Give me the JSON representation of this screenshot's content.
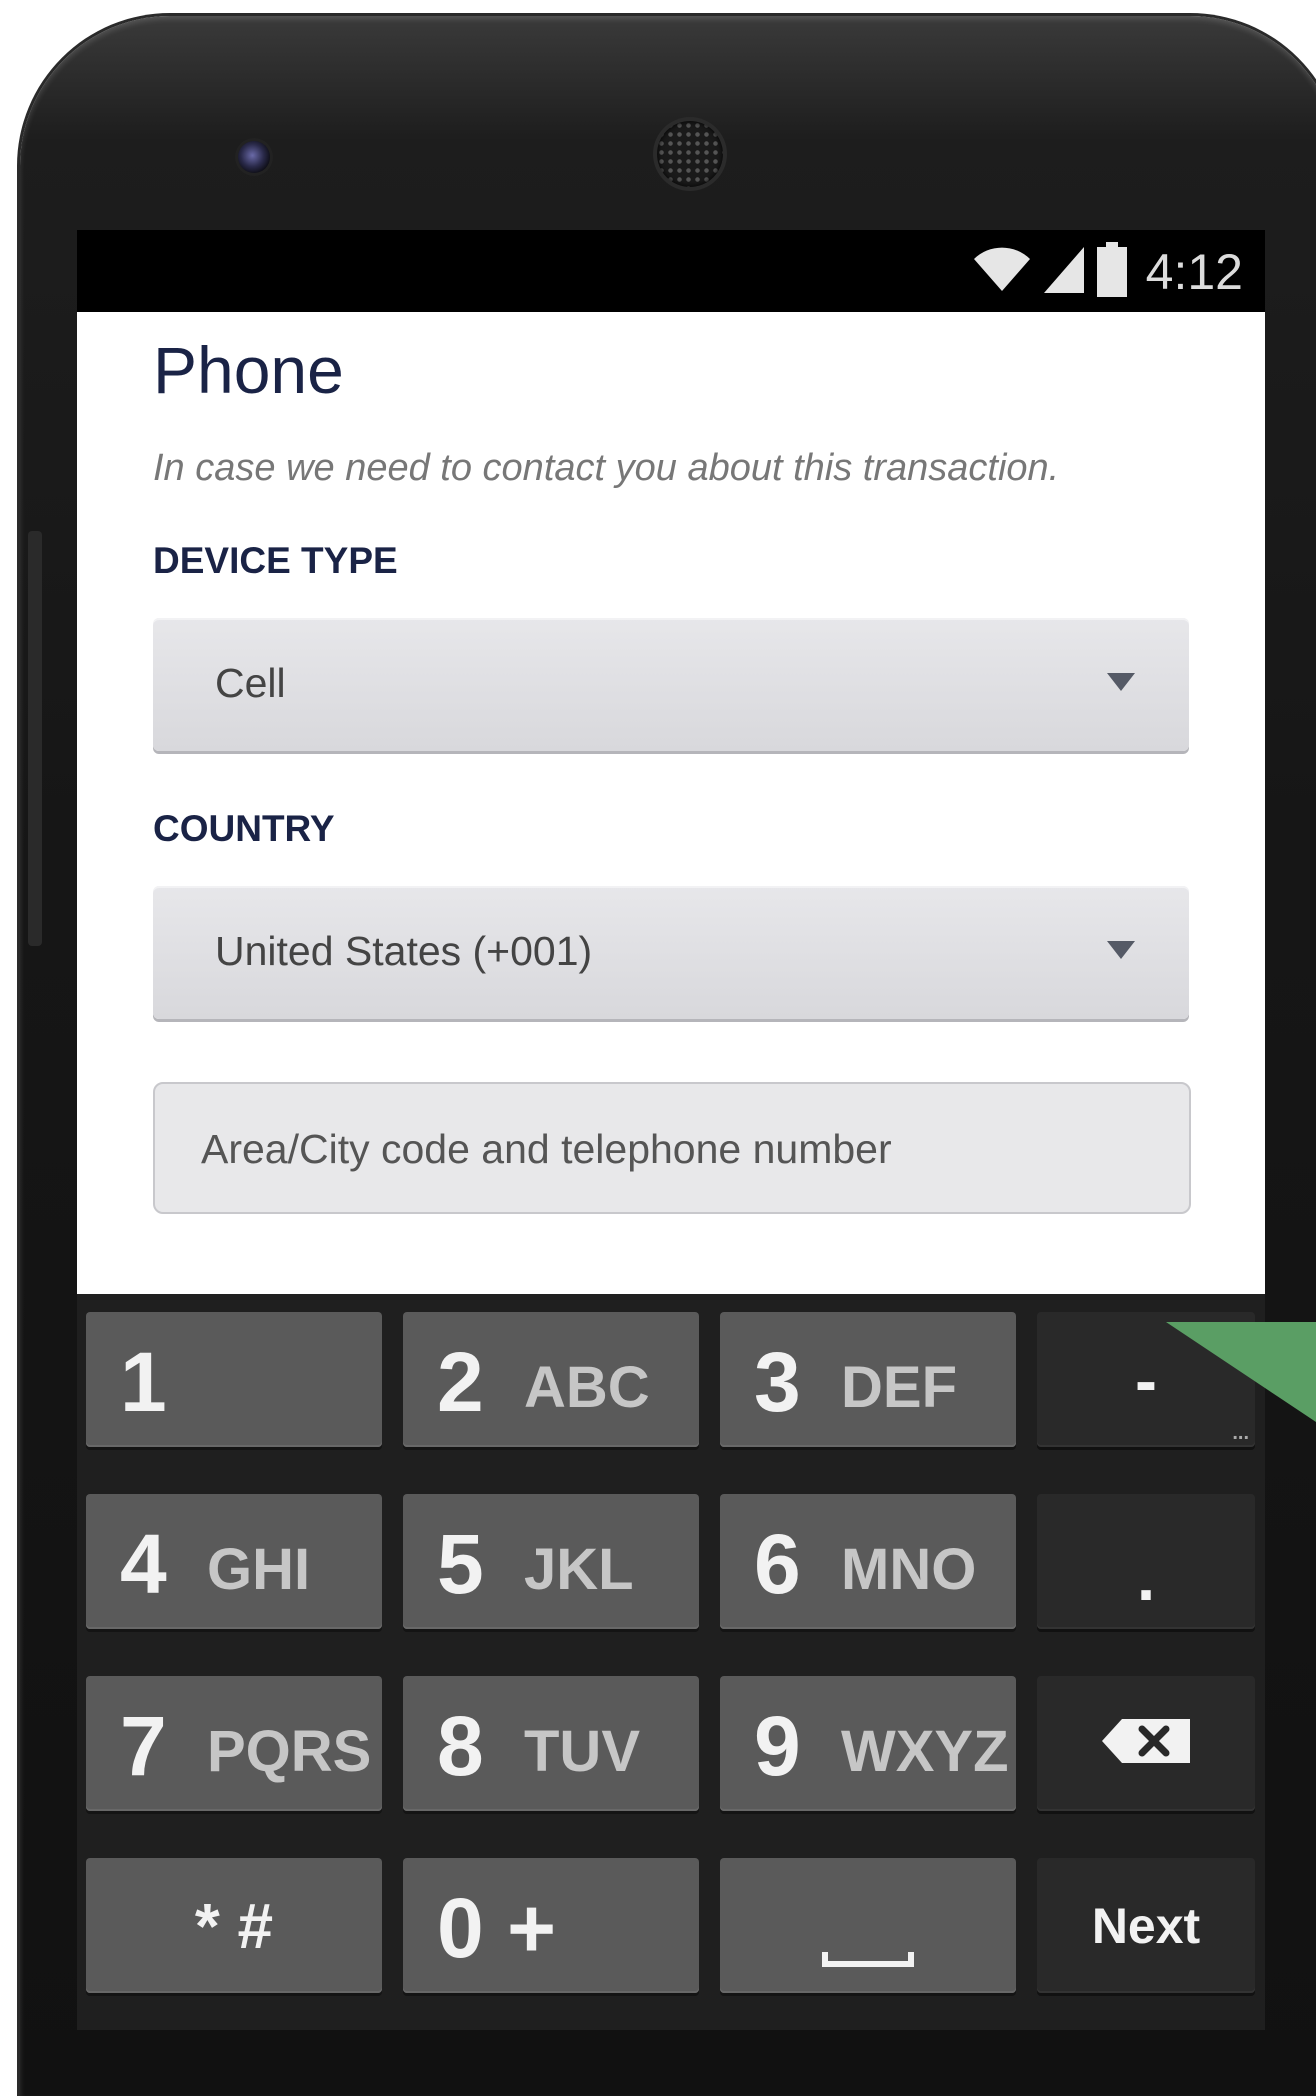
{
  "status_bar": {
    "time": "4:12",
    "icons": [
      "wifi-icon",
      "signal-icon",
      "battery-icon"
    ]
  },
  "form": {
    "title": "Phone",
    "subtitle": "In case we need to contact you about this transaction.",
    "device_type": {
      "label": "DEVICE TYPE",
      "value": "Cell"
    },
    "country": {
      "label": "COUNTRY",
      "value": "United States (+001)"
    },
    "phone_number": {
      "value": "",
      "placeholder": "Area/City code and telephone number"
    }
  },
  "keypad": {
    "keys": [
      {
        "num": "1",
        "letters": ""
      },
      {
        "num": "2",
        "letters": "ABC"
      },
      {
        "num": "3",
        "letters": "DEF"
      },
      {
        "num": "4",
        "letters": "GHI"
      },
      {
        "num": "5",
        "letters": "JKL"
      },
      {
        "num": "6",
        "letters": "MNO"
      },
      {
        "num": "7",
        "letters": "PQRS"
      },
      {
        "num": "8",
        "letters": "TUV"
      },
      {
        "num": "9",
        "letters": "WXYZ"
      },
      {
        "num": "0 +",
        "letters": ""
      }
    ],
    "star_hash": "* #",
    "dash": "-",
    "dash_more": "...",
    "period": ".",
    "next": "Next"
  },
  "colors": {
    "title_navy": "#1a2346",
    "key_gray": "#5a5a5a",
    "key_dark": "#292929",
    "accent_green": "#5a9e64"
  }
}
